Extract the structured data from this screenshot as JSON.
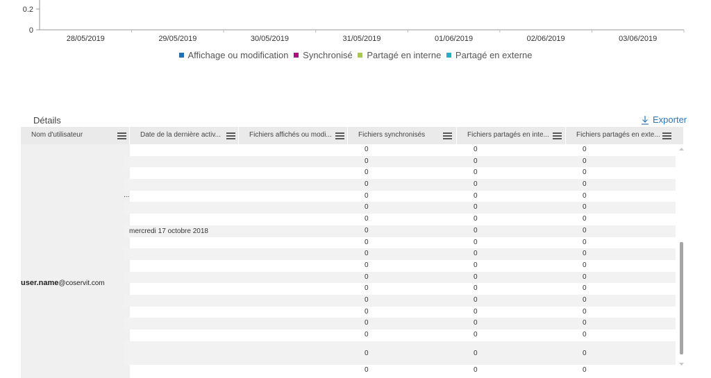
{
  "chart_data": {
    "type": "line",
    "x": [
      "28/05/2019",
      "29/05/2019",
      "30/05/2019",
      "31/05/2019",
      "01/06/2019",
      "02/06/2019",
      "03/06/2019"
    ],
    "y_ticks": [
      "0.2",
      "0"
    ],
    "series": [
      {
        "name": "Affichage ou modification",
        "color": "#1f6fb5",
        "values": [
          0,
          0,
          0,
          0,
          0,
          0,
          0
        ]
      },
      {
        "name": "Synchronisé",
        "color": "#a4167f",
        "values": [
          0,
          0,
          0,
          0,
          0,
          0,
          0
        ]
      },
      {
        "name": "Partagé en interne",
        "color": "#a8c94b",
        "values": [
          0,
          0,
          0,
          0,
          0,
          0,
          0
        ]
      },
      {
        "name": "Partagé en externe",
        "color": "#1fb2c2",
        "values": [
          0,
          0,
          0,
          0,
          0,
          0,
          0
        ]
      }
    ],
    "title": "",
    "xlabel": "",
    "ylabel": ""
  },
  "details": {
    "title": "Détails",
    "export_label": "Exporter",
    "columns": [
      "Nom d'utilisateur",
      "Date de la dernière activ...",
      "Fichiers affichés ou modi...",
      "Fichiers synchronisés",
      "Fichiers partagés en inte...",
      "Fichiers partagés en exte..."
    ],
    "user": {
      "name_bold": "user.name",
      "domain": "@coservit.com"
    },
    "ellipsis": "...",
    "last_activity": "mercredi 17 octobre 2018",
    "cell_value": "0",
    "row_count": 19
  },
  "colors": {
    "accent": "#2e75b6",
    "header_bg": "#eaeaea",
    "row_alt": "#f2f2f2"
  }
}
